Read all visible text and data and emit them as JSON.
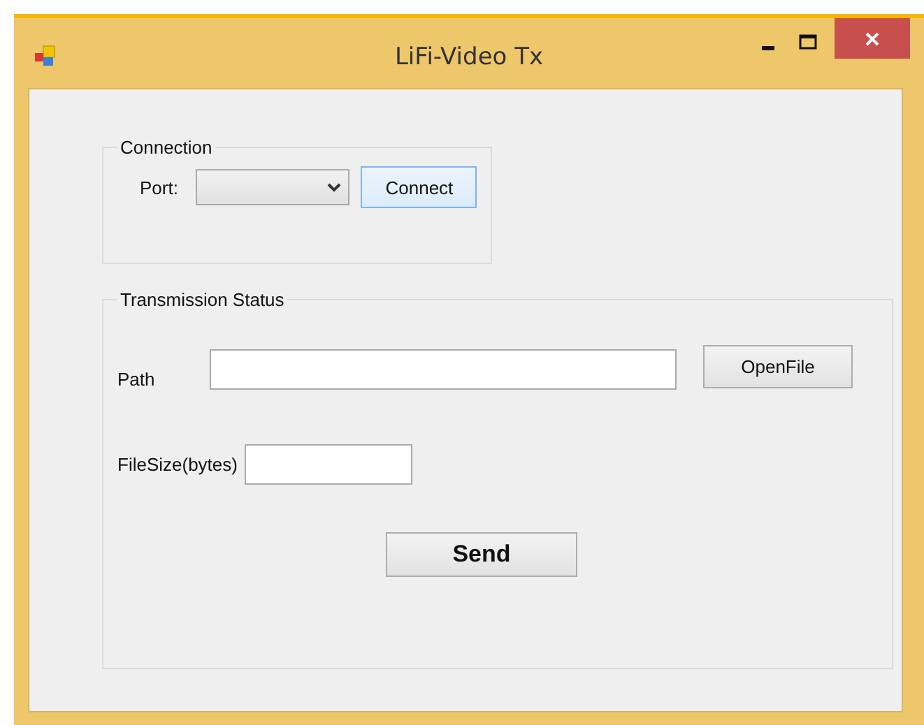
{
  "window": {
    "title": "LiFi-Video Tx"
  },
  "connection": {
    "legend": "Connection",
    "port_label": "Port:",
    "connect_button": "Connect"
  },
  "transmission": {
    "legend": "Transmission Status",
    "path_label": "Path",
    "open_button": "OpenFile",
    "size_label": "FileSize(bytes)",
    "send_button": "Send"
  }
}
